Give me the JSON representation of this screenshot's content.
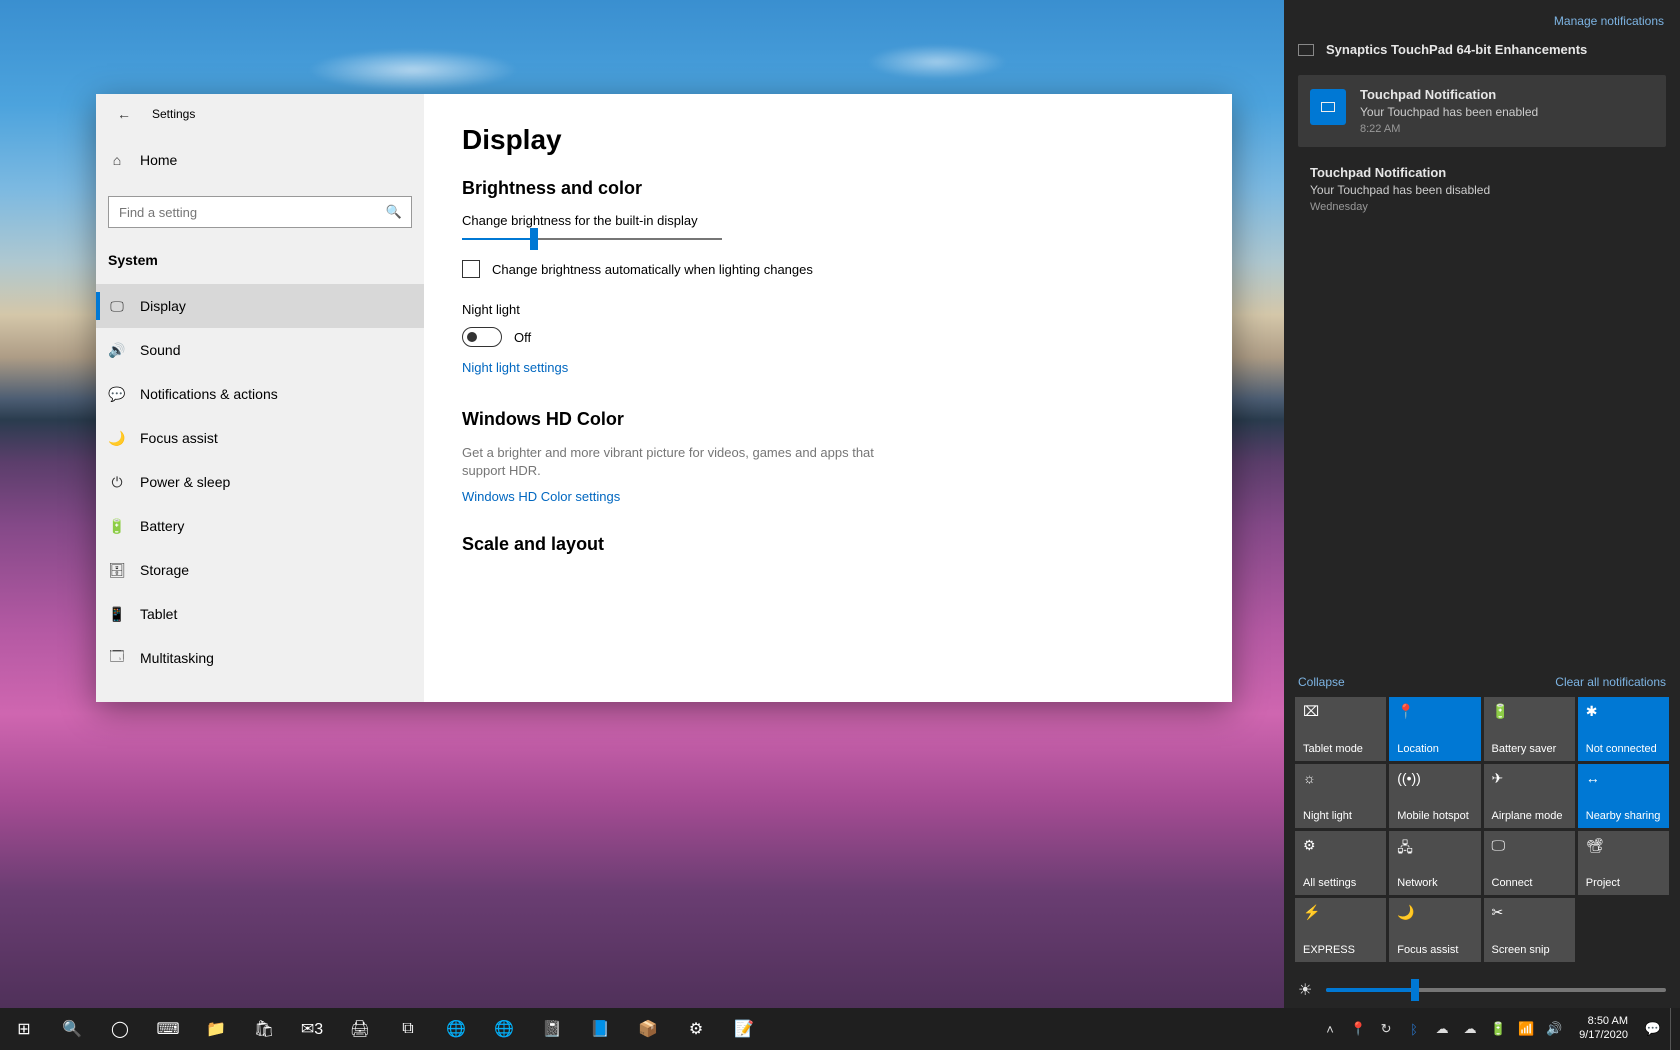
{
  "settings": {
    "title": "Settings",
    "home": "Home",
    "search_placeholder": "Find a setting",
    "category": "System",
    "nav": [
      {
        "icon": "🖵",
        "label": "Display",
        "selected": true
      },
      {
        "icon": "🔊",
        "label": "Sound"
      },
      {
        "icon": "💬",
        "label": "Notifications & actions"
      },
      {
        "icon": "🌙",
        "label": "Focus assist"
      },
      {
        "icon": "⏻",
        "label": "Power & sleep"
      },
      {
        "icon": "🔋",
        "label": "Battery"
      },
      {
        "icon": "🗄",
        "label": "Storage"
      },
      {
        "icon": "📱",
        "label": "Tablet"
      },
      {
        "icon": "🗔",
        "label": "Multitasking"
      }
    ],
    "content": {
      "page_title": "Display",
      "section_brightness": "Brightness and color",
      "brightness_label": "Change brightness for the built-in display",
      "auto_brightness": "Change brightness automatically when lighting changes",
      "night_light": "Night light",
      "night_light_state": "Off",
      "night_light_link": "Night light settings",
      "section_hd": "Windows HD Color",
      "hd_desc": "Get a brighter and more vibrant picture for videos, games and apps that support HDR.",
      "hd_link": "Windows HD Color settings",
      "section_scale": "Scale and layout"
    }
  },
  "action_center": {
    "manage": "Manage notifications",
    "group_title": "Synaptics TouchPad 64-bit Enhancements",
    "notifications": [
      {
        "title": "Touchpad Notification",
        "text": "Your Touchpad has been enabled",
        "time": "8:22 AM",
        "hasIcon": true
      },
      {
        "title": "Touchpad Notification",
        "text": "Your Touchpad has been disabled",
        "time": "Wednesday",
        "hasIcon": false
      }
    ],
    "collapse": "Collapse",
    "clear_all": "Clear all notifications",
    "tiles": [
      {
        "icon": "⌧",
        "label": "Tablet mode",
        "active": false
      },
      {
        "icon": "�człow",
        "label": "Location",
        "active": true,
        "iconOverride": "📍"
      },
      {
        "icon": "🔋",
        "label": "Battery saver",
        "active": false
      },
      {
        "icon": "ᚼ",
        "label": "Not connected",
        "active": true,
        "iconOverride": "✱"
      },
      {
        "icon": "☼",
        "label": "Night light",
        "active": false
      },
      {
        "icon": "📶",
        "label": "Mobile hotspot",
        "active": false,
        "iconOverride": "((•))"
      },
      {
        "icon": "✈",
        "label": "Airplane mode",
        "active": false
      },
      {
        "icon": "🔗",
        "label": "Nearby sharing",
        "active": true,
        "iconOverride": "↔"
      },
      {
        "icon": "⚙",
        "label": "All settings",
        "active": false
      },
      {
        "icon": "🖧",
        "label": "Network",
        "active": false
      },
      {
        "icon": "🖵",
        "label": "Connect",
        "active": false
      },
      {
        "icon": "📽",
        "label": "Project",
        "active": false
      },
      {
        "icon": "⚡",
        "label": "EXPRESS",
        "active": false
      },
      {
        "icon": "🌙",
        "label": "Focus assist",
        "active": false
      },
      {
        "icon": "✂",
        "label": "Screen snip",
        "active": false
      }
    ]
  },
  "taskbar": {
    "time": "8:50 AM",
    "date": "9/17/2020",
    "apps": [
      "⊞",
      "🔍",
      "◯",
      "⌨",
      "📁",
      "🛍",
      "✉3",
      "🖨",
      "⧉",
      "🌐",
      "🌐",
      "📓",
      "📘",
      "📦",
      "⚙",
      "📝"
    ]
  }
}
